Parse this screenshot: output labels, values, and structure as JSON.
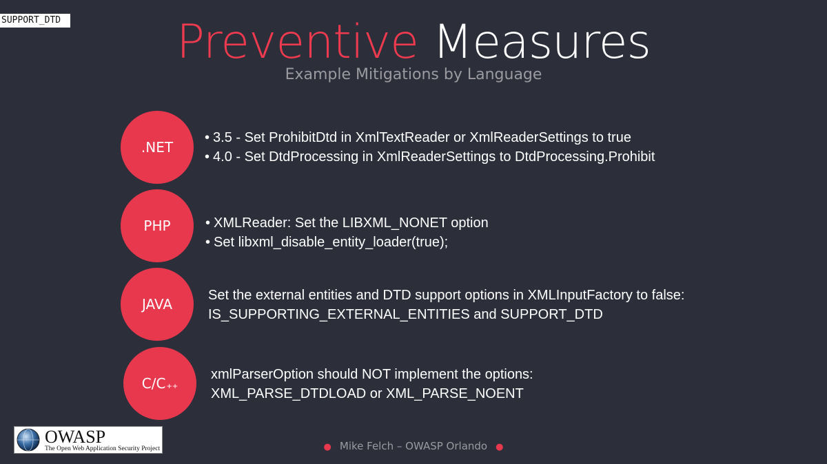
{
  "tag": "SUPPORT_DTD",
  "title": {
    "word1": "Preventive",
    "word2": "Measures"
  },
  "subtitle": "Example Mitigations by Language",
  "sections": [
    {
      "label": ".NET",
      "bullets": [
        "3.5 - Set ProhibitDtd in XmlTextReader or XmlReaderSettings to true",
        "4.0 - Set DtdProcessing in XmlReaderSettings to DtdProcessing.Prohibit"
      ]
    },
    {
      "label": "PHP",
      "bullets": [
        "XMLReader: Set the LIBXML_NONET option",
        "Set libxml_disable_entity_loader(true);"
      ]
    },
    {
      "label": "JAVA",
      "lines": [
        "Set the external entities and DTD support options in XMLInputFactory to false:",
        "IS_SUPPORTING_EXTERNAL_ENTITIES and SUPPORT_DTD"
      ]
    },
    {
      "label": "C/C",
      "label_sup": "++",
      "lines": [
        "xmlParserOption should NOT implement the options:",
        "XML_PARSE_DTDLOAD or XML_PARSE_NOENT"
      ]
    }
  ],
  "logo": {
    "name": "OWASP",
    "tagline": "The Open Web Application Security Project"
  },
  "footer": "Mike Felch – OWASP Orlando",
  "colors": {
    "accent": "#e8384e",
    "background": "#2c2f3a"
  }
}
